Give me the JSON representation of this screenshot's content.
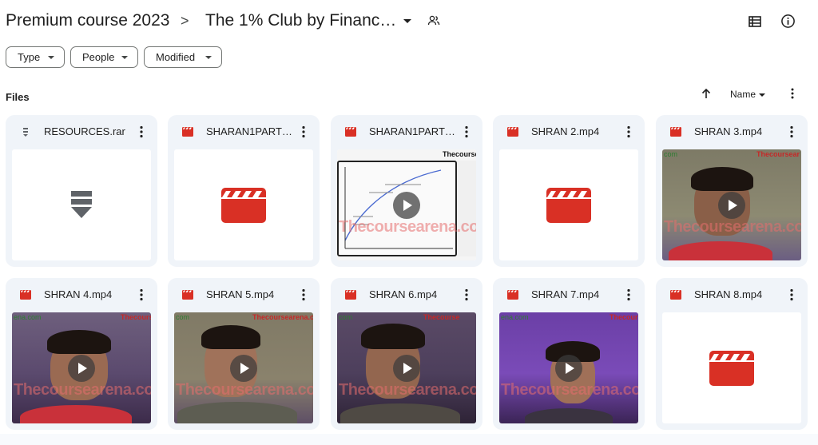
{
  "breadcrumb": {
    "root": "Premium course 2023",
    "separator": ">",
    "current": "The 1% Club by Finance ..."
  },
  "filters": [
    {
      "label": "Type"
    },
    {
      "label": "People"
    },
    {
      "label": "Modified"
    }
  ],
  "section": {
    "title": "Files",
    "sort_label": "Name"
  },
  "colors": {
    "card_bg": "#f0f4f9",
    "video_red": "#d93025",
    "text": "#1f1f1f"
  },
  "files": [
    {
      "name": "RESOURCES.rar",
      "kind": "archive"
    },
    {
      "name": "SHARAN1PART1....",
      "kind": "video-placeholder"
    },
    {
      "name": "SHARAN1PART2....",
      "kind": "video-thumb"
    },
    {
      "name": "SHRAN 2.mp4",
      "kind": "video-placeholder"
    },
    {
      "name": "SHRAN 3.mp4",
      "kind": "video-thumb"
    },
    {
      "name": "SHRAN 4.mp4",
      "kind": "video-thumb"
    },
    {
      "name": "SHRAN 5.mp4",
      "kind": "video-thumb"
    },
    {
      "name": "SHRAN 6.mp4",
      "kind": "video-thumb"
    },
    {
      "name": "SHRAN 7.mp4",
      "kind": "video-thumb"
    },
    {
      "name": "SHRAN 8.mp4",
      "kind": "video-placeholder"
    }
  ],
  "watermarks": {
    "brand": "Thecoursearena.com",
    "brand_short": "Thecourse",
    "brand_red": "Thecoursear",
    "site_tail": "ena.com",
    "site_tail_short": "com"
  }
}
